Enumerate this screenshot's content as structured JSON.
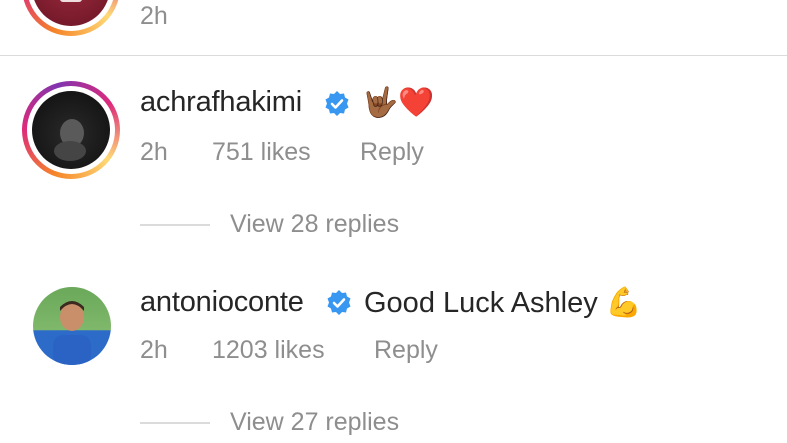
{
  "top_comment": {
    "time": "2h"
  },
  "comments": [
    {
      "username": "achrafhakimi",
      "verified": true,
      "text": "🤟🏾❤️",
      "time": "2h",
      "likes": "751 likes",
      "reply_label": "Reply",
      "view_replies": "View 28 replies"
    },
    {
      "username": "antonioconte",
      "verified": true,
      "text": "Good Luck Ashley 💪",
      "time": "2h",
      "likes": "1203 likes",
      "reply_label": "Reply",
      "view_replies": "View 27 replies"
    }
  ],
  "colors": {
    "verified_blue": "#3897f0",
    "meta_gray": "#8e8e8e",
    "divider": "#dbdbdb"
  }
}
